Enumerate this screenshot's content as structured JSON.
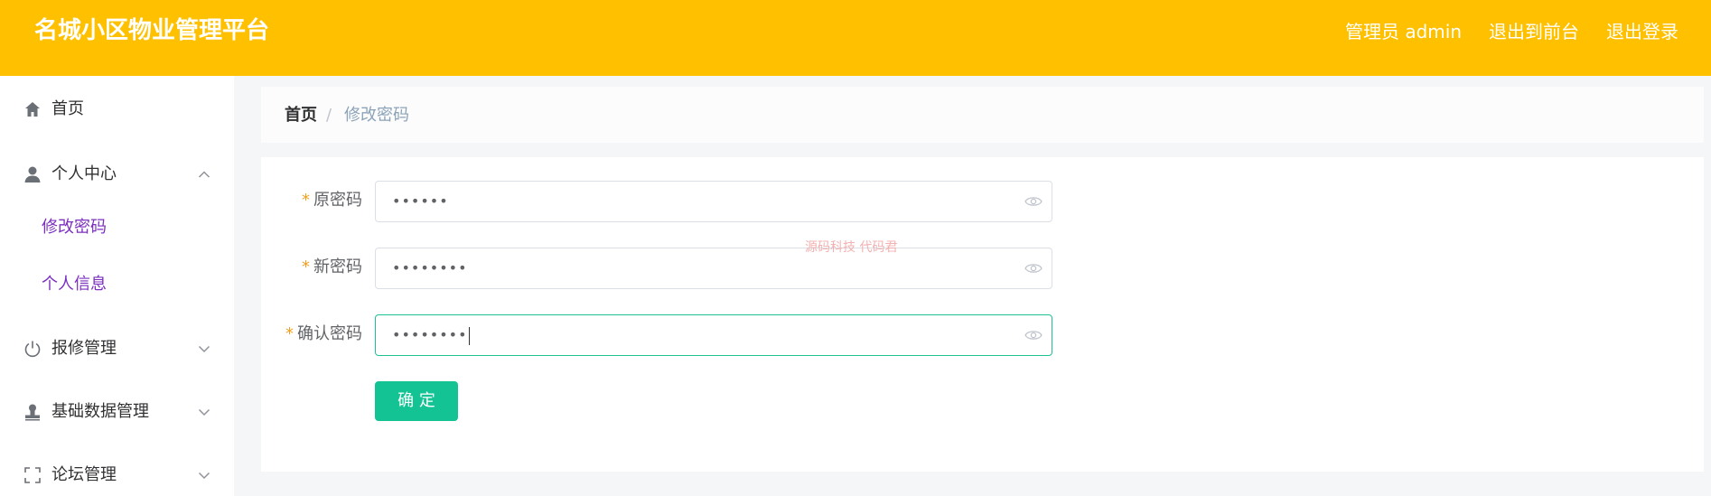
{
  "header": {
    "brand": "名城小区物业管理平台",
    "links": [
      "管理员 admin",
      "退出到前台",
      "退出登录"
    ]
  },
  "sidebar": {
    "items": [
      {
        "label": "首页",
        "icon": "home-icon"
      },
      {
        "label": "个人中心",
        "icon": "user-icon",
        "expanded": true,
        "children": [
          {
            "label": "修改密码"
          },
          {
            "label": "个人信息"
          }
        ]
      },
      {
        "label": "报修管理",
        "icon": "power-icon"
      },
      {
        "label": "基础数据管理",
        "icon": "stamp-icon"
      },
      {
        "label": "论坛管理",
        "icon": "fullscreen-icon"
      }
    ]
  },
  "breadcrumb": {
    "home": "首页",
    "separator": "/",
    "current": "修改密码"
  },
  "form": {
    "fields": [
      {
        "label": "原密码",
        "value": "••••••"
      },
      {
        "label": "新密码",
        "value": "••••••••"
      },
      {
        "label": "确认密码",
        "value": "••••••••"
      }
    ],
    "required_mark": "*",
    "submit_label": "确 定"
  },
  "watermark": "源码科技 代码君",
  "colors": {
    "header_bg": "#ffc000",
    "accent": "#14c393",
    "submenu_text": "#7b2fbf",
    "required_star": "#f0a020"
  }
}
